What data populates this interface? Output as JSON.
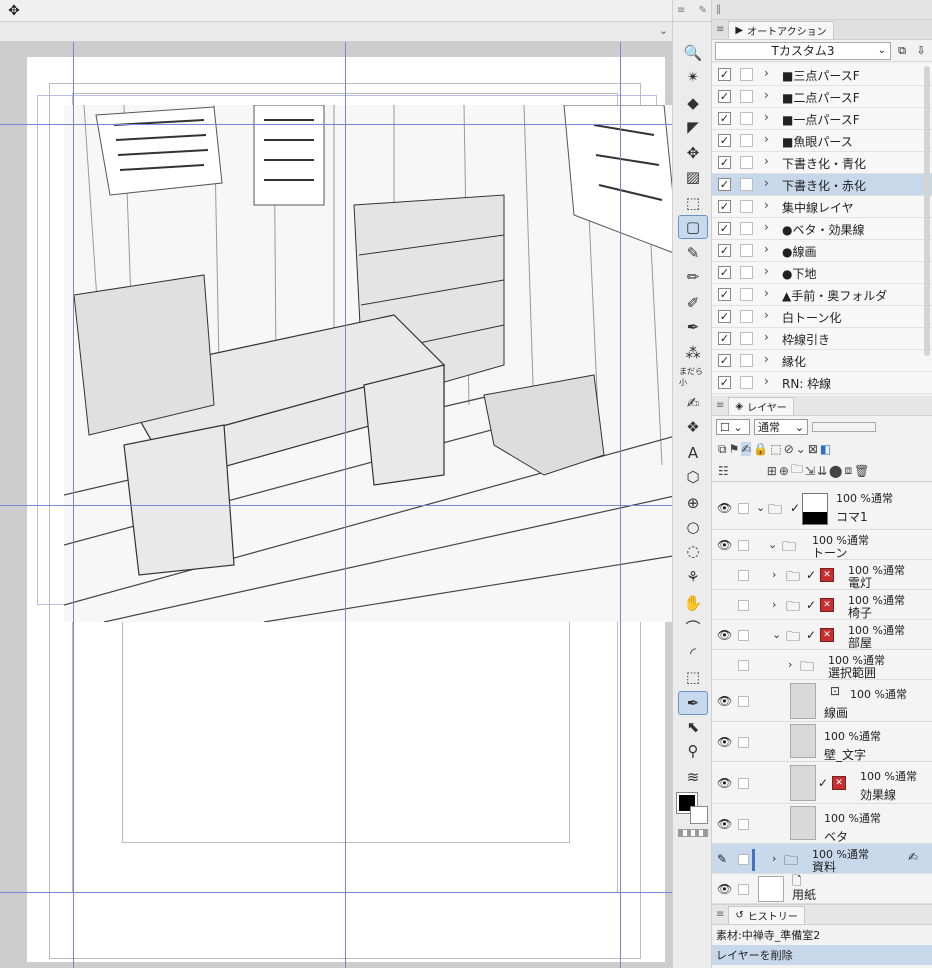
{
  "top_toolbar": {
    "move_icon": "move-arrows-icon"
  },
  "tools": [
    {
      "icon": "zoom-icon",
      "glyph": "🔍"
    },
    {
      "icon": "magic-wand-icon",
      "glyph": "✴"
    },
    {
      "icon": "fill-icon",
      "glyph": "◆"
    },
    {
      "icon": "operation-icon",
      "glyph": "◤"
    },
    {
      "icon": "move-icon",
      "glyph": "✥"
    },
    {
      "icon": "gradient-icon",
      "glyph": "▨"
    },
    {
      "icon": "eraser-icon",
      "glyph": "⬚"
    },
    {
      "icon": "frame-icon",
      "glyph": "▢",
      "active": true
    },
    {
      "icon": "pen-icon",
      "glyph": "✎"
    },
    {
      "icon": "pencil-icon",
      "glyph": "✏"
    },
    {
      "icon": "marker-icon",
      "glyph": "✐"
    },
    {
      "icon": "brush-icon",
      "glyph": "✒"
    },
    {
      "icon": "airbrush-icon",
      "glyph": "⁂"
    },
    {
      "icon": "decoration-icon",
      "glyph": "まだら小"
    },
    {
      "icon": "blend-icon",
      "glyph": "✍"
    },
    {
      "icon": "pattern-icon",
      "glyph": "❖"
    },
    {
      "icon": "text-icon",
      "glyph": "A"
    },
    {
      "icon": "3d-object-icon",
      "glyph": "⬡"
    },
    {
      "icon": "ruler-icon",
      "glyph": "⊕"
    },
    {
      "icon": "balloon-icon",
      "glyph": "○"
    },
    {
      "icon": "balloon-tail-icon",
      "glyph": "◌"
    },
    {
      "icon": "liquify-icon",
      "glyph": "⚘"
    },
    {
      "icon": "hand-icon",
      "glyph": "✋"
    },
    {
      "icon": "correction-icon",
      "glyph": "⌒"
    },
    {
      "icon": "curve-icon",
      "glyph": "◜"
    },
    {
      "icon": "selection-icon",
      "glyph": "⬚"
    },
    {
      "icon": "pen-active-icon",
      "glyph": "✒",
      "active": true
    },
    {
      "icon": "object-select-icon",
      "glyph": "⬉"
    },
    {
      "icon": "eyedropper-icon",
      "glyph": "⚲"
    },
    {
      "icon": "paper-icon",
      "glyph": "≋"
    }
  ],
  "auto_action": {
    "tab_label": "オートアクション",
    "set_name": "Tカスタム3",
    "items": [
      {
        "label": "■三点パースF",
        "enabled": true
      },
      {
        "label": "■二点パースF",
        "enabled": true
      },
      {
        "label": "■一点パースF",
        "enabled": true
      },
      {
        "label": "■魚眼パース",
        "enabled": true
      },
      {
        "label": "下書き化・青化",
        "enabled": true
      },
      {
        "label": "下書き化・赤化",
        "enabled": true,
        "selected": true
      },
      {
        "label": "集中線レイヤ",
        "enabled": true
      },
      {
        "label": "●ベタ・効果線",
        "enabled": true
      },
      {
        "label": "●線画",
        "enabled": true
      },
      {
        "label": "●下地",
        "enabled": true
      },
      {
        "label": "▲手前・奥フォルダ",
        "enabled": true
      },
      {
        "label": "白トーン化",
        "enabled": true
      },
      {
        "label": "枠線引き",
        "enabled": true
      },
      {
        "label": "縁化",
        "enabled": true
      },
      {
        "label": "RN: 枠線",
        "enabled": true
      }
    ]
  },
  "layer_panel": {
    "tab_label": "レイヤー",
    "blend_mode": "通常",
    "layers": [
      {
        "op": "100 %通常",
        "name": "コマ1"
      },
      {
        "op": "100 %通常",
        "name": "トーン"
      },
      {
        "op": "100 %通常",
        "name": "電灯"
      },
      {
        "op": "100 %通常",
        "name": "椅子"
      },
      {
        "op": "100 %通常",
        "name": "部屋"
      },
      {
        "op": "100 %通常",
        "name": "選択範囲"
      },
      {
        "op": "100 %通常",
        "name": "線画"
      },
      {
        "op": "100 %通常",
        "name": "壁_文字"
      },
      {
        "op": "100 %通常",
        "name": "効果線"
      },
      {
        "op": "100 %通常",
        "name": "ベタ"
      },
      {
        "op": "100 %通常",
        "name": "資料"
      },
      {
        "op": "",
        "name": "用紙"
      }
    ]
  },
  "history": {
    "tab_label": "ヒストリー",
    "items": [
      "素材:中禅寺_準備室2",
      "レイヤーを削除"
    ]
  }
}
